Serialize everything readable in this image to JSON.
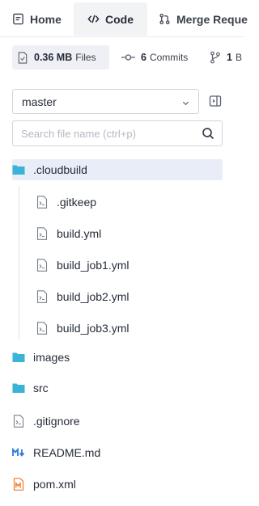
{
  "tabs": [
    {
      "label": "Home",
      "icon": "file-code-icon"
    },
    {
      "label": "Code",
      "icon": "code-brackets-icon"
    },
    {
      "label": "Merge Reque",
      "icon": "merge-request-icon"
    }
  ],
  "stats": {
    "files_size": "0.36 MB",
    "files_label": "Files",
    "commits_count": "6",
    "commits_label": "Commits",
    "branches_count": "1",
    "branches_label": "B"
  },
  "branch": {
    "selected": "master"
  },
  "search": {
    "placeholder": "Search file name (ctrl+p)"
  },
  "tree": [
    {
      "name": ".cloudbuild",
      "type": "folder",
      "expanded": true
    },
    {
      "name": ".gitkeep",
      "type": "file",
      "parent": ".cloudbuild"
    },
    {
      "name": "build.yml",
      "type": "file",
      "parent": ".cloudbuild"
    },
    {
      "name": "build_job1.yml",
      "type": "file",
      "parent": ".cloudbuild"
    },
    {
      "name": "build_job2.yml",
      "type": "file",
      "parent": ".cloudbuild"
    },
    {
      "name": "build_job3.yml",
      "type": "file",
      "parent": ".cloudbuild"
    },
    {
      "name": "images",
      "type": "folder"
    },
    {
      "name": "src",
      "type": "folder"
    },
    {
      "name": ".gitignore",
      "type": "file"
    },
    {
      "name": "README.md",
      "type": "markdown"
    },
    {
      "name": "pom.xml",
      "type": "maven"
    }
  ],
  "colors": {
    "folder": "#3bb3d6",
    "markdown": "#2e7bd6",
    "maven": "#f07a2a",
    "active_row": "#e9edf8"
  }
}
